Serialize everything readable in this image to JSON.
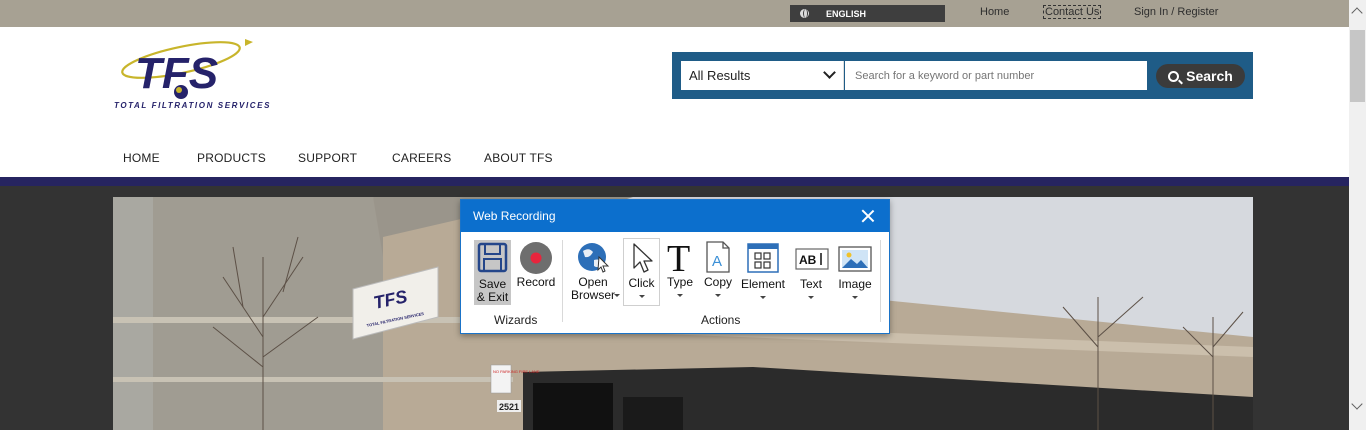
{
  "topbar": {
    "language": "ENGLISH",
    "links": [
      "Home",
      "Contact Us",
      "Sign In / Register"
    ]
  },
  "logo": {
    "wordmark": "TFS",
    "tagline": "TOTAL FILTRATION SERVICES"
  },
  "search": {
    "scope_value": "All Results",
    "placeholder": "Search for a keyword or part number",
    "button_label": "Search"
  },
  "nav": {
    "items": [
      "HOME",
      "PRODUCTS",
      "SUPPORT",
      "CAREERS",
      "ABOUT TFS"
    ]
  },
  "hero": {
    "sign_text": "TFS",
    "sign_subtext": "TOTAL FILTRATION SERVICES",
    "address_number": "2521",
    "no_parking_sign": "NO PARKING FIRE LANE"
  },
  "dialog": {
    "title": "Web Recording",
    "groups": {
      "wizards": "Wizards",
      "actions": "Actions"
    },
    "tools": {
      "save_exit_line1": "Save",
      "save_exit_line2": "& Exit",
      "record": "Record",
      "open_browser_line1": "Open",
      "open_browser_line2": "Browser",
      "click": "Click",
      "type": "Type",
      "copy": "Copy",
      "element": "Element",
      "text": "Text",
      "image": "Image"
    }
  },
  "colors": {
    "topbar": "#a7a193",
    "brand_navy": "#262460",
    "search_frame": "#1f5c87",
    "dialog_accent": "#0c6fcd",
    "record_red": "#e8253d"
  }
}
